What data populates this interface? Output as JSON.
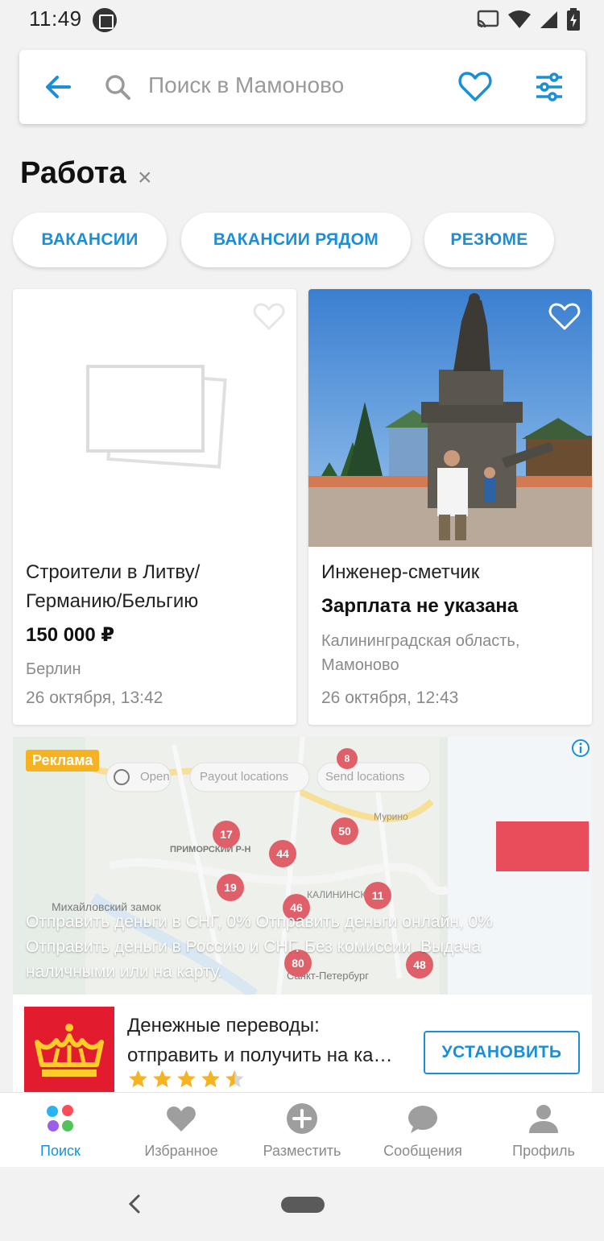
{
  "status_bar": {
    "time": "11:49"
  },
  "search": {
    "placeholder": "Поиск в Мамоново"
  },
  "heading": {
    "title": "Работа",
    "clear": "×"
  },
  "chips": [
    {
      "label": "ВАКАНСИИ"
    },
    {
      "label": "ВАКАНСИИ РЯДОМ"
    },
    {
      "label": "РЕЗЮМЕ"
    }
  ],
  "listings": [
    {
      "title": "Строители в Литву/ Германию/Бельгию",
      "price": "150 000 ₽",
      "location": "Берлин",
      "date": "26 октября, 13:42"
    },
    {
      "title": "Инженер-сметчик",
      "price": "Зарплата не указана",
      "location": "Калининградская область, Мамоново",
      "date": "26 октября, 12:43"
    }
  ],
  "ad": {
    "badge": "Реклама",
    "description": "Отправить деньги в СНГ, 0% Отправить деньги онлайн, 0% Отправить деньги в Россию и СНГ. Без комиссии. Выдача наличными или на карту.",
    "title_line1": "Денежные переводы:",
    "title_line2": "отправить и получить на ка…",
    "rating": 4.5,
    "install_label": "УСТАНОВИТЬ",
    "map_labels": {
      "open": "Open",
      "payout": "Payout locations",
      "send": "Send locations",
      "district": "ПРИМОРСКИЙ Р-Н",
      "castle": "Михайловский замок",
      "murino": "Мурино",
      "kalininsky": "КАЛИНИНСКИЙ",
      "spb": "Санкт-Петербург"
    },
    "map_pins": [
      "8",
      "17",
      "50",
      "44",
      "19",
      "11",
      "46",
      "80",
      "48"
    ]
  },
  "bottom_nav": [
    {
      "label": "Поиск",
      "icon": "search-dots-icon",
      "active": true
    },
    {
      "label": "Избранное",
      "icon": "heart-icon",
      "active": false
    },
    {
      "label": "Разместить",
      "icon": "plus-circle-icon",
      "active": false
    },
    {
      "label": "Сообщения",
      "icon": "chat-bubble-icon",
      "active": false
    },
    {
      "label": "Профиль",
      "icon": "person-icon",
      "active": false
    }
  ],
  "colors": {
    "accent": "#1a8fd7",
    "ad_badge": "#f5b323",
    "ad_logo": "#e31b2e",
    "star": "#f5b323"
  }
}
